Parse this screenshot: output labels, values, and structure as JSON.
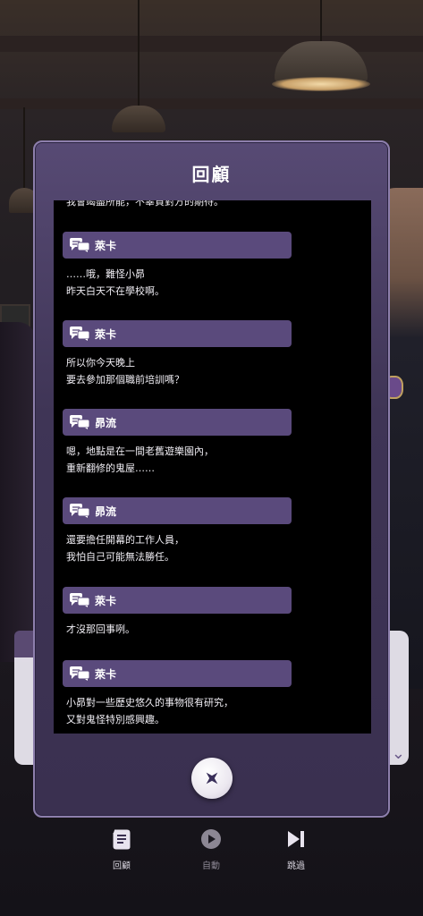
{
  "panel": {
    "title": "回顧",
    "truncated_top_line": "我會竭盡所能，不辜負對方的期待。",
    "entries": [
      {
        "speaker": "萊卡",
        "text": "……哦，難怪小昴\n昨天白天不在學校啊。"
      },
      {
        "speaker": "萊卡",
        "text": "所以你今天晚上\n要去參加那個職前培訓嗎？"
      },
      {
        "speaker": "昴流",
        "text": "嗯，地點是在一間老舊遊樂園內，\n重新翻修的鬼屋……"
      },
      {
        "speaker": "昴流",
        "text": "還要擔任開幕的工作人員，\n我怕自己可能無法勝任。"
      },
      {
        "speaker": "萊卡",
        "text": "才沒那回事咧。"
      },
      {
        "speaker": "萊卡",
        "text": "小昴對一些歷史悠久的事物很有研究，\n又對鬼怪特別感興趣。"
      }
    ],
    "close_icon": "close-x-icon"
  },
  "menu": {
    "review": {
      "label": "回顧",
      "icon": "scroll-icon"
    },
    "auto": {
      "label": "自動",
      "icon": "play-circle-icon"
    },
    "skip": {
      "label": "跳過",
      "icon": "skip-forward-icon"
    }
  },
  "colors": {
    "panel": "#3f3556",
    "speaker_bar": "#5a4a7c",
    "log_bg": "#000000"
  }
}
